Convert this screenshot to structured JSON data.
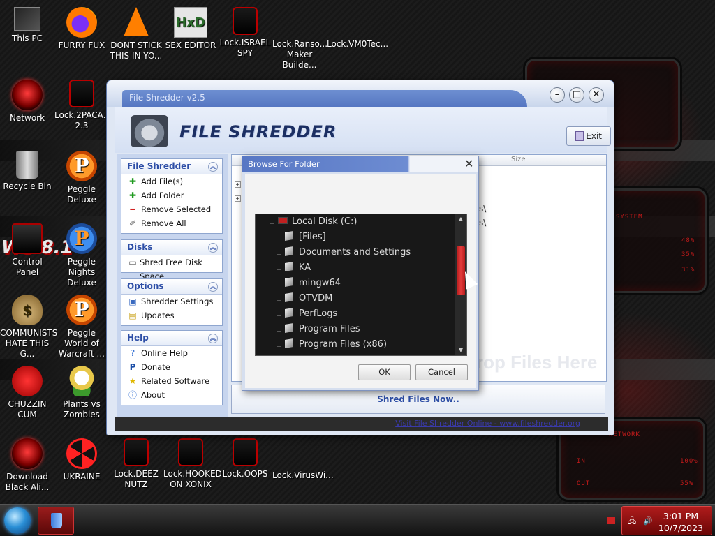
{
  "desktop": {
    "icons": [
      {
        "label": "This PC"
      },
      {
        "label": "FURRY FUX"
      },
      {
        "label": "DONT STICK THIS IN YO..."
      },
      {
        "label": "SEX EDITOR"
      },
      {
        "label": "Lock.ISRAEL SPY"
      },
      {
        "label": "Lock.Ranso... Maker Builde..."
      },
      {
        "label": "Lock.VM0Tec..."
      },
      {
        "label": "Network"
      },
      {
        "label": "Lock.2PACA... 2.3"
      },
      {
        "label": "Recycle Bin"
      },
      {
        "label": "Peggle Deluxe"
      },
      {
        "label": "Control Panel"
      },
      {
        "label": "Peggle Nights Deluxe"
      },
      {
        "label": "COMMUNISTS HATE THIS G..."
      },
      {
        "label": "Peggle World of Warcraft ..."
      },
      {
        "label": "CHUZZIN CUM"
      },
      {
        "label": "Plants vs Zombies"
      },
      {
        "label": "Download Black Ali..."
      },
      {
        "label": "UKRAINE"
      },
      {
        "label": "Lock.DEEZ NUTZ"
      },
      {
        "label": "Lock.HOOKED ON XONIX"
      },
      {
        "label": "Lock.OOPS"
      },
      {
        "label": "Lock.VirusWi..."
      }
    ],
    "deco_texts": [
      "SYSTEM",
      "NETWORK",
      "IN",
      "OUT",
      "48%",
      "35%",
      "31%",
      "100%",
      "55%",
      "WS 8.1"
    ]
  },
  "window": {
    "title": "File Shredder v2.5",
    "app_name": "FILE SHREDDER",
    "exit_label": "Exit",
    "sidebar": {
      "groups": [
        {
          "title": "File Shredder",
          "items": [
            "Add File(s)",
            "Add Folder",
            "Remove Selected",
            "Remove All"
          ]
        },
        {
          "title": "Disks",
          "items": [
            "Shred Free Disk Space"
          ]
        },
        {
          "title": "Options",
          "items": [
            "Shredder Settings",
            "Updates"
          ]
        },
        {
          "title": "Help",
          "items": [
            "Online Help",
            "Donate",
            "Related Software",
            "About"
          ]
        }
      ]
    },
    "list": {
      "size_header": "Size",
      "path_fragments": [
        "s\\",
        "s\\"
      ],
      "drop_hint": "rop Files Here"
    },
    "shred_button": "Shred Files Now..",
    "status_link": "Visit File Shredder Online - www.fileshredder.org"
  },
  "dialog": {
    "title": "Browse For Folder",
    "tree": [
      {
        "label": "Local Disk (C:)",
        "type": "drive"
      },
      {
        "label": "[Files]",
        "type": "folder"
      },
      {
        "label": "Documents and Settings",
        "type": "folder"
      },
      {
        "label": "KA",
        "type": "folder"
      },
      {
        "label": "mingw64",
        "type": "folder"
      },
      {
        "label": "OTVDM",
        "type": "folder"
      },
      {
        "label": "PerfLogs",
        "type": "folder"
      },
      {
        "label": "Program Files",
        "type": "folder"
      },
      {
        "label": "Program Files (x86)",
        "type": "folder"
      }
    ],
    "ok_label": "OK",
    "cancel_label": "Cancel"
  },
  "taskbar": {
    "time": "3:01 PM",
    "date": "10/7/2023"
  },
  "colors": {
    "accent": "#2d4ea6",
    "title_bar": "#5877c4",
    "scroll_thumb": "#c62222",
    "tray": "#a81818"
  }
}
